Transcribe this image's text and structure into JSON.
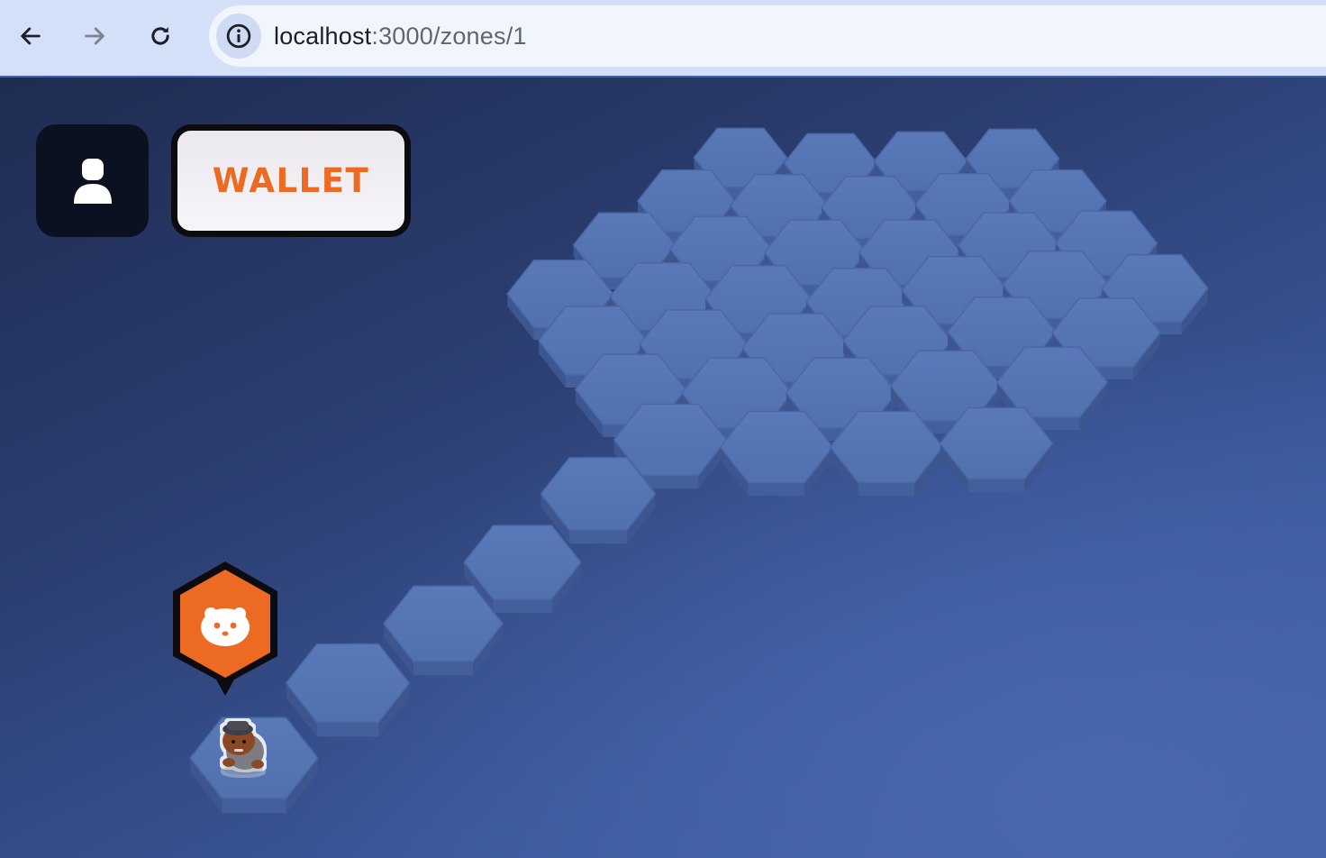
{
  "browser": {
    "url_host": "localhost",
    "url_rest": ":3000/zones/1",
    "icons": [
      "back-arrow-icon",
      "forward-arrow-icon",
      "reload-icon",
      "site-info-icon"
    ]
  },
  "hud": {
    "profile_icon": "user-icon",
    "wallet_label": "WALLET"
  },
  "player": {
    "badge_icon": "bear-face-icon",
    "badge_color": "#ec6a21",
    "character": "player-character"
  },
  "colors": {
    "accent": "#ec6a21",
    "tile_top": "#5574b2",
    "background": "#2c3f72"
  }
}
